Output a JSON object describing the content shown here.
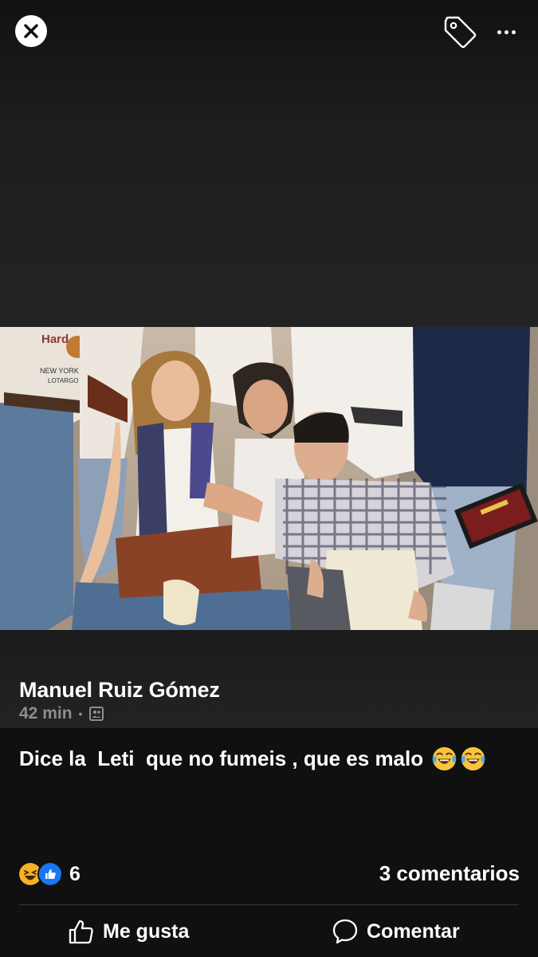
{
  "post": {
    "author": "Manuel Ruiz Gómez",
    "time": "42 min",
    "separator": "•",
    "audience_icon": "friends-audience-icon",
    "caption": "Dice la  Leti  que no fumeis , que es malo ",
    "caption_emoji": "face-with-tears-of-joy"
  },
  "photo": {
    "shirt_text_1": "Hard",
    "shirt_text_2": "NEW YORK LOT",
    "shirt_text_3": "LOTARGO"
  },
  "engagement": {
    "reaction_icons": [
      "laughing-icon",
      "like-icon"
    ],
    "reaction_count": "6",
    "comments_label": "3 comentarios"
  },
  "actions": {
    "like_label": "Me gusta",
    "comment_label": "Comentar"
  },
  "colors": {
    "background": "#101010",
    "like_blue": "#1877f2",
    "haha_yellow": "#f7b125",
    "meta_gray": "#8b8d90"
  }
}
